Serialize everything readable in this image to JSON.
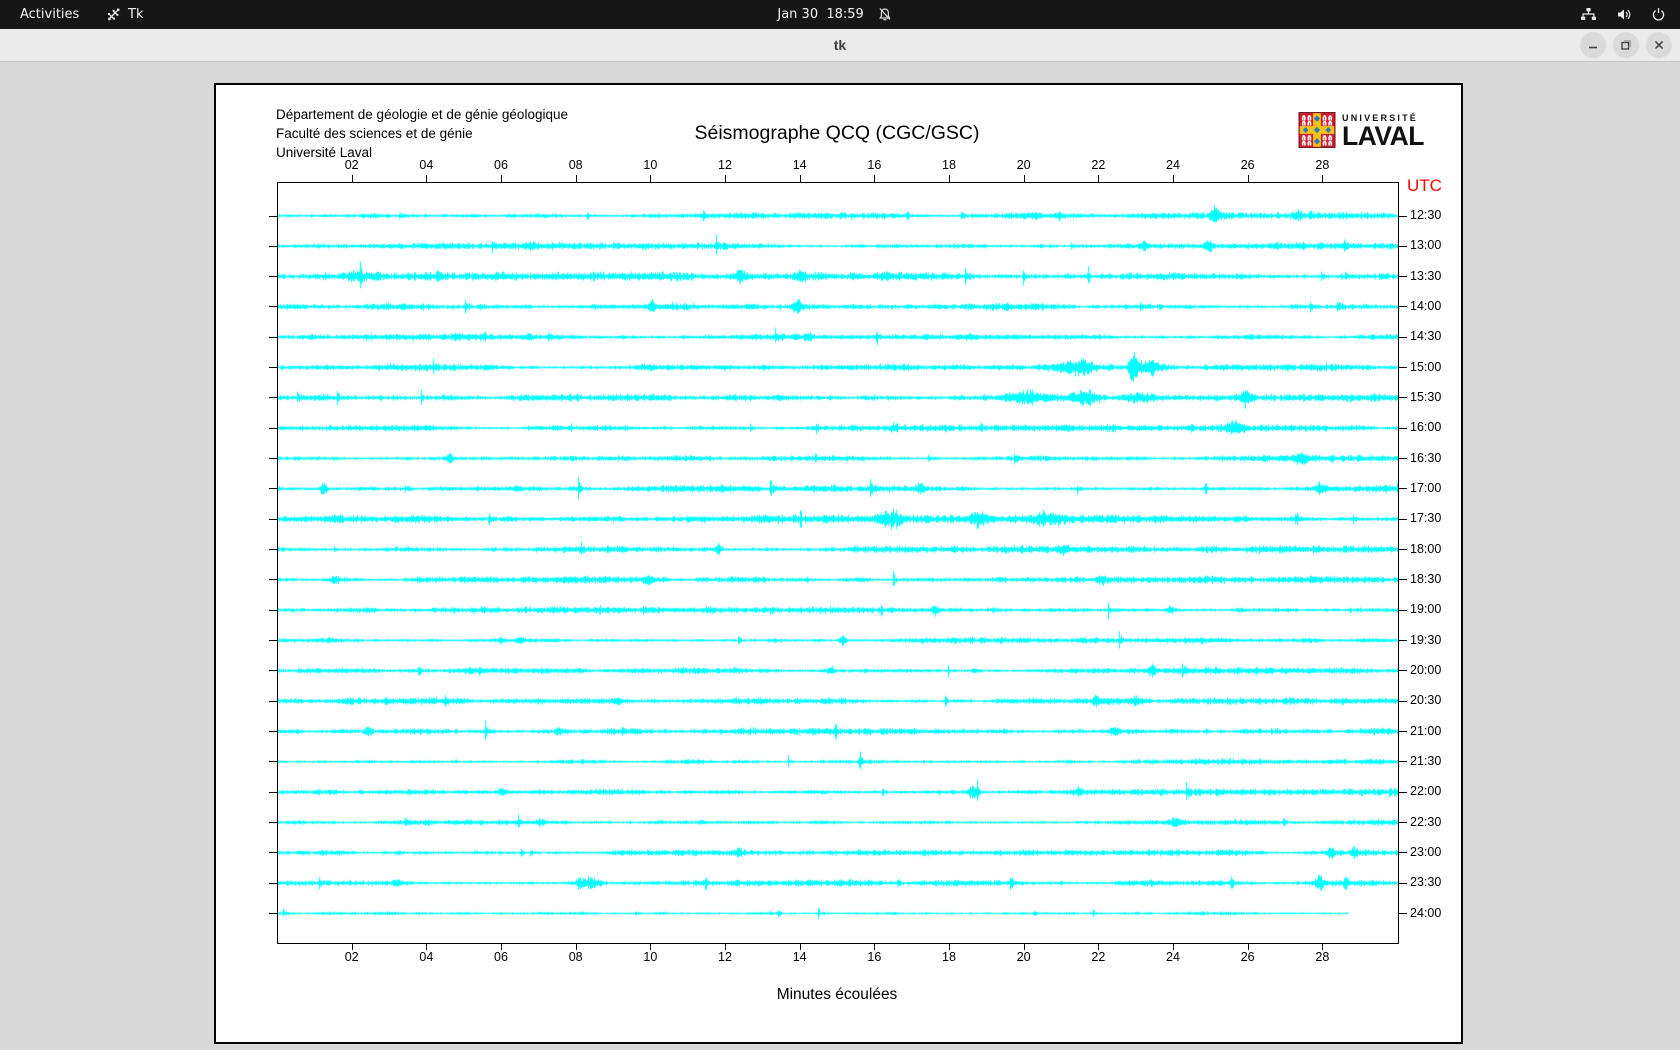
{
  "topbar": {
    "activities_label": "Activities",
    "app_indicator_label": "Tk",
    "clock": "Jan 30  18:59",
    "icons": [
      "tk-icon",
      "bell-muted-icon",
      "network-icon",
      "volume-icon",
      "power-icon"
    ]
  },
  "titlebar": {
    "title": "tk",
    "controls": [
      "minimize",
      "maximize",
      "close"
    ]
  },
  "seismograph": {
    "institution_lines": [
      "Département de géologie et de génie géologique",
      "Faculté des sciences et de génie",
      "Université Laval"
    ],
    "title": "Séismographe QCQ (CGC/GSC)",
    "logo": {
      "line1": "UNIVERSITÉ",
      "line2": "LAVAL"
    },
    "utc_label": "UTC",
    "xlabel": "Minutes écoulées",
    "trace_color": "#00ffff",
    "utc_color": "#ff0000",
    "logo_colors": {
      "shield_red": "#d21f2f",
      "shield_border": "#7a1929",
      "cross_gold": "#f6c21a",
      "ornament_blue": "#2a7fb8"
    }
  },
  "chart_data": {
    "type": "line",
    "variant": "seismograph-helicorder",
    "title": "Séismographe QCQ (CGC/GSC)",
    "xlabel": "Minutes écoulées",
    "x_unit": "minutes",
    "x_range": [
      0,
      30
    ],
    "x_ticks": [
      "02",
      "04",
      "06",
      "08",
      "10",
      "12",
      "14",
      "16",
      "18",
      "20",
      "22",
      "24",
      "26",
      "28"
    ],
    "row_axis_label": "UTC",
    "row_interval_minutes": 30,
    "row_labels": [
      "12:30",
      "13:00",
      "13:30",
      "14:00",
      "14:30",
      "15:00",
      "15:30",
      "16:00",
      "16:30",
      "17:00",
      "17:30",
      "18:00",
      "18:30",
      "19:00",
      "19:30",
      "20:00",
      "20:30",
      "21:00",
      "21:30",
      "22:00",
      "22:30",
      "23:00",
      "23:30",
      "24:00"
    ],
    "row_end_minutes": [
      30,
      30,
      30,
      30,
      30,
      30,
      30,
      30,
      30,
      30,
      30,
      30,
      30,
      30,
      30,
      30,
      30,
      30,
      30,
      30,
      30,
      30,
      30,
      28.7
    ],
    "noisiness": [
      1.0,
      1.0,
      1.25,
      1.1,
      1.0,
      1.05,
      1.1,
      1.0,
      0.95,
      1.1,
      1.3,
      1.05,
      1.1,
      0.95,
      0.9,
      0.95,
      1.0,
      1.05,
      0.9,
      0.95,
      0.85,
      0.9,
      1.0,
      0.65
    ],
    "seed": 424242,
    "events": [
      {
        "row": 0,
        "minute": 25.1,
        "amp": 10,
        "width": 0.12
      },
      {
        "row": 0,
        "minute": 27.3,
        "amp": 6,
        "width": 0.1
      },
      {
        "row": 1,
        "minute": 6.8,
        "amp": 5,
        "width": 0.1
      },
      {
        "row": 1,
        "minute": 23.2,
        "amp": 5,
        "width": 0.08
      },
      {
        "row": 1,
        "minute": 24.9,
        "amp": 7,
        "width": 0.1
      },
      {
        "row": 2,
        "minute": 2.0,
        "amp": 5,
        "width": 0.12
      },
      {
        "row": 2,
        "minute": 12.4,
        "amp": 6,
        "width": 0.15
      },
      {
        "row": 2,
        "minute": 14.0,
        "amp": 5,
        "width": 0.1
      },
      {
        "row": 3,
        "minute": 10.0,
        "amp": 7,
        "width": 0.1
      },
      {
        "row": 3,
        "minute": 13.9,
        "amp": 6,
        "width": 0.12
      },
      {
        "row": 4,
        "minute": 5.5,
        "amp": 5,
        "width": 0.1
      },
      {
        "row": 4,
        "minute": 14.2,
        "amp": 4,
        "width": 0.1
      },
      {
        "row": 5,
        "minute": 21.4,
        "amp": 8,
        "width": 0.5
      },
      {
        "row": 5,
        "minute": 22.9,
        "amp": 26,
        "width": 0.1
      },
      {
        "row": 5,
        "minute": 23.3,
        "amp": 10,
        "width": 0.25
      },
      {
        "row": 6,
        "minute": 20.0,
        "amp": 7,
        "width": 0.6
      },
      {
        "row": 6,
        "minute": 21.6,
        "amp": 8,
        "width": 0.4
      },
      {
        "row": 6,
        "minute": 23.1,
        "amp": 6,
        "width": 0.5
      },
      {
        "row": 6,
        "minute": 25.9,
        "amp": 8,
        "width": 0.1
      },
      {
        "row": 7,
        "minute": 16.5,
        "amp": 4,
        "width": 0.1
      },
      {
        "row": 7,
        "minute": 25.6,
        "amp": 6,
        "width": 0.25
      },
      {
        "row": 8,
        "minute": 4.6,
        "amp": 6,
        "width": 0.1
      },
      {
        "row": 8,
        "minute": 27.4,
        "amp": 6,
        "width": 0.2
      },
      {
        "row": 9,
        "minute": 1.2,
        "amp": 6,
        "width": 0.1
      },
      {
        "row": 9,
        "minute": 17.2,
        "amp": 5,
        "width": 0.1
      },
      {
        "row": 9,
        "minute": 27.9,
        "amp": 7,
        "width": 0.12
      },
      {
        "row": 10,
        "minute": 16.4,
        "amp": 7,
        "width": 0.3
      },
      {
        "row": 10,
        "minute": 18.8,
        "amp": 7,
        "width": 0.25
      },
      {
        "row": 10,
        "minute": 20.6,
        "amp": 6,
        "width": 0.35
      },
      {
        "row": 11,
        "minute": 11.8,
        "amp": 7,
        "width": 0.08
      },
      {
        "row": 11,
        "minute": 21.0,
        "amp": 5,
        "width": 0.15
      },
      {
        "row": 12,
        "minute": 1.5,
        "amp": 5,
        "width": 0.1
      },
      {
        "row": 12,
        "minute": 9.9,
        "amp": 5,
        "width": 0.12
      },
      {
        "row": 12,
        "minute": 22.1,
        "amp": 5,
        "width": 0.15
      },
      {
        "row": 13,
        "minute": 17.6,
        "amp": 5,
        "width": 0.1
      },
      {
        "row": 13,
        "minute": 23.9,
        "amp": 5,
        "width": 0.12
      },
      {
        "row": 14,
        "minute": 6.5,
        "amp": 4,
        "width": 0.1
      },
      {
        "row": 14,
        "minute": 15.1,
        "amp": 6,
        "width": 0.08
      },
      {
        "row": 15,
        "minute": 14.8,
        "amp": 4,
        "width": 0.1
      },
      {
        "row": 15,
        "minute": 23.4,
        "amp": 6,
        "width": 0.1
      },
      {
        "row": 16,
        "minute": 9.1,
        "amp": 4,
        "width": 0.1
      },
      {
        "row": 16,
        "minute": 21.9,
        "amp": 5,
        "width": 0.12
      },
      {
        "row": 16,
        "minute": 23.0,
        "amp": 5,
        "width": 0.1
      },
      {
        "row": 17,
        "minute": 2.4,
        "amp": 5,
        "width": 0.1
      },
      {
        "row": 17,
        "minute": 7.5,
        "amp": 5,
        "width": 0.08
      },
      {
        "row": 17,
        "minute": 22.4,
        "amp": 5,
        "width": 0.15
      },
      {
        "row": 18,
        "minute": 15.6,
        "amp": 13,
        "width": 0.05
      },
      {
        "row": 19,
        "minute": 6.0,
        "amp": 4,
        "width": 0.1
      },
      {
        "row": 19,
        "minute": 18.6,
        "amp": 7,
        "width": 0.15
      },
      {
        "row": 19,
        "minute": 21.4,
        "amp": 5,
        "width": 0.12
      },
      {
        "row": 20,
        "minute": 7.0,
        "amp": 4,
        "width": 0.1
      },
      {
        "row": 20,
        "minute": 24.0,
        "amp": 4,
        "width": 0.15
      },
      {
        "row": 21,
        "minute": 12.3,
        "amp": 5,
        "width": 0.1
      },
      {
        "row": 21,
        "minute": 28.2,
        "amp": 7,
        "width": 0.1
      },
      {
        "row": 21,
        "minute": 28.8,
        "amp": 6,
        "width": 0.08
      },
      {
        "row": 22,
        "minute": 3.2,
        "amp": 5,
        "width": 0.1
      },
      {
        "row": 22,
        "minute": 8.3,
        "amp": 6,
        "width": 0.25
      },
      {
        "row": 22,
        "minute": 27.9,
        "amp": 7,
        "width": 0.12
      },
      {
        "row": 22,
        "minute": 28.6,
        "amp": 5,
        "width": 0.08
      },
      {
        "row": 23,
        "minute": 13.4,
        "amp": 5,
        "width": 0.06
      }
    ],
    "grid": false,
    "legend": false
  }
}
